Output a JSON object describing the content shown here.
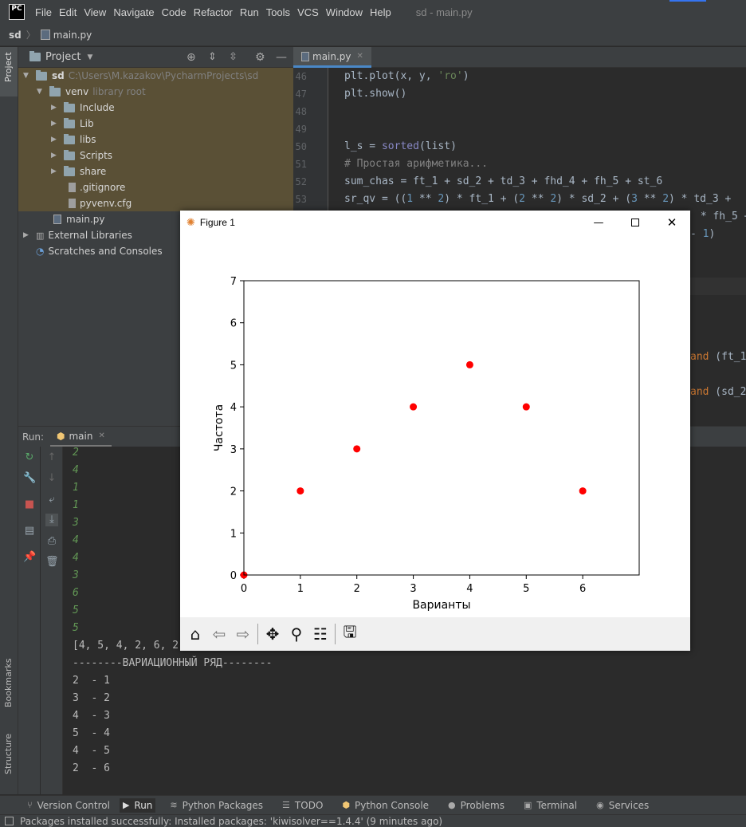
{
  "app": {
    "logo_text": "PC",
    "menu": [
      "File",
      "Edit",
      "View",
      "Navigate",
      "Code",
      "Refactor",
      "Run",
      "Tools",
      "VCS",
      "Window",
      "Help"
    ],
    "window_title": "sd - main.py"
  },
  "breadcrumb": {
    "project": "sd",
    "file": "main.py"
  },
  "left_stripe": {
    "top_tab": "Project",
    "bookmarks_tab": "Bookmarks",
    "structure_tab": "Structure"
  },
  "project_panel": {
    "title": "Project",
    "root_name": "sd",
    "root_path": "C:\\Users\\M.kazakov\\PycharmProjects\\sd",
    "venv_name": "venv",
    "venv_hint": "library root",
    "venv_children": [
      "Include",
      "Lib",
      "libs",
      "Scripts",
      "share"
    ],
    "venv_files": [
      ".gitignore",
      "pyvenv.cfg"
    ],
    "main_file": "main.py",
    "external_libraries": "External Libraries",
    "scratches": "Scratches and Consoles"
  },
  "editor": {
    "tab_label": "main.py",
    "line_numbers": [
      "46",
      "47",
      "48",
      "49",
      "50",
      "51",
      "52",
      "53"
    ],
    "lines": {
      "l46_a": "plt.plot(x, y, ",
      "l46_s": "'ro'",
      "l46_b": ")",
      "l47": "plt.show()",
      "l50_a": "l_s = ",
      "l50_b": "sorted",
      "l50_c": "(list)",
      "l51": "# Простая арифметика...",
      "l52": "sum_chas = ft_1 + sd_2 + td_3 + fhd_4 + fh_5 + st_6",
      "l53_a": "sr_qv = ((",
      "l53_n1": "1",
      "l53_b": " ** ",
      "l53_n2": "2",
      "l53_c": ") * ft_1 + (",
      "l53_n3": "2",
      "l53_d": " ** ",
      "l53_n4": "2",
      "l53_e": ") * sd_2 + (",
      "l53_n5": "3",
      "l53_f": " ** ",
      "l53_n6": "2",
      "l53_g": ") * td_3 +",
      "frag1": " * fh_5 +",
      "frag2_a": "- ",
      "frag2_n": "1",
      "frag2_b": ")",
      "frag3_k": "and",
      "frag3_b": " (ft_1",
      "frag4_k": "and",
      "frag4_b": " (sd_2"
    }
  },
  "run_panel": {
    "label": "Run:",
    "tab_label": "main",
    "input_lines": [
      "2",
      "4",
      "1",
      "1",
      "3",
      "4",
      "4",
      "3",
      "6",
      "5",
      "5"
    ],
    "output_lines": [
      "[4, 5, 4, 2, 6, 2, ...",
      "--------ВАРИАЦИОННЫЙ РЯД--------",
      "2  - 1",
      "3  - 2",
      "4  - 3",
      "5  - 4",
      "4  - 5",
      "2  - 6"
    ]
  },
  "bottom_tabs": [
    "Version Control",
    "Run",
    "Python Packages",
    "TODO",
    "Python Console",
    "Problems",
    "Terminal",
    "Services"
  ],
  "status": "Packages installed successfully: Installed packages: 'kiwisolver==1.4.4' (9 minutes ago)",
  "figure": {
    "title": "Figure 1",
    "toolbar_icons": [
      "home-icon",
      "back-icon",
      "forward-icon",
      "pan-icon",
      "zoom-icon",
      "configure-icon",
      "save-icon"
    ]
  },
  "chart_data": {
    "type": "scatter",
    "title": "",
    "xlabel": "Варианты",
    "ylabel": "Частота",
    "xlim": [
      0,
      7
    ],
    "ylim": [
      0,
      7
    ],
    "xticks": [
      0,
      1,
      2,
      3,
      4,
      5,
      6
    ],
    "yticks": [
      0,
      1,
      2,
      3,
      4,
      5,
      6,
      7
    ],
    "grid": false,
    "marker_color": "#ff0000",
    "x": [
      0,
      1,
      2,
      3,
      4,
      5,
      6
    ],
    "y": [
      0,
      2,
      3,
      4,
      5,
      4,
      2
    ]
  }
}
